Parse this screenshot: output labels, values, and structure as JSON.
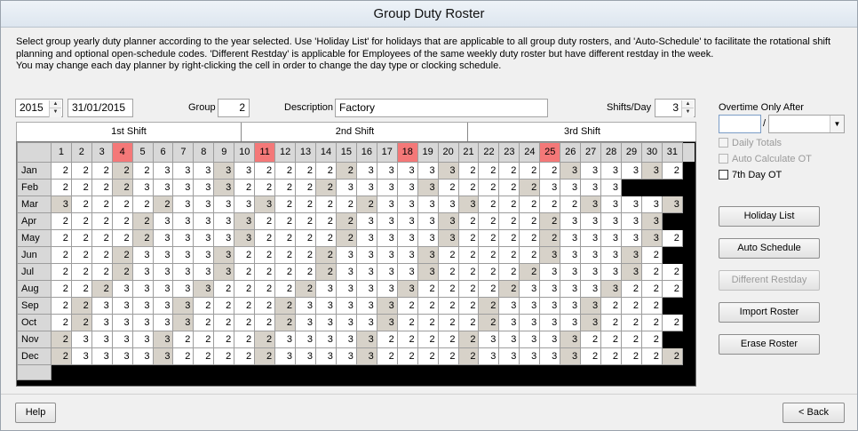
{
  "window": {
    "title": "Group Duty Roster"
  },
  "instructions": [
    "Select group yearly duty planner according to the year selected. Use 'Holiday List' for holidays that are applicable to all group duty rosters, and 'Auto-Schedule' to facilitate the rotational shift",
    "planning and  optional open-schedule codes. 'Different Restday' is applicable for Employees of the same weekly duty roster but have different restday in the week.",
    "You may change each day planner by right-clicking the cell in order to change the day type or clocking schedule."
  ],
  "form": {
    "year": "2015",
    "date": "31/01/2015",
    "group_label": "Group",
    "group_value": "2",
    "description_label": "Description",
    "description_value": "Factory",
    "shifts_label": "Shifts/Day",
    "shifts_value": "3"
  },
  "shifts": [
    "1st Shift",
    "2nd Shift",
    "3rd Shift"
  ],
  "grid": {
    "days": [
      "1",
      "2",
      "3",
      "4",
      "5",
      "6",
      "7",
      "8",
      "9",
      "10",
      "11",
      "12",
      "13",
      "14",
      "15",
      "16",
      "17",
      "18",
      "19",
      "20",
      "21",
      "22",
      "23",
      "24",
      "25",
      "26",
      "27",
      "28",
      "29",
      "30",
      "31"
    ],
    "holiday_days": [
      4,
      11,
      18,
      25
    ],
    "months": [
      "Jan",
      "Feb",
      "Mar",
      "Apr",
      "May",
      "Jun",
      "Jul",
      "Aug",
      "Sep",
      "Oct",
      "Nov",
      "Dec"
    ],
    "month_lengths": [
      31,
      28,
      31,
      30,
      31,
      30,
      31,
      31,
      30,
      31,
      30,
      31
    ],
    "rows": [
      [
        "2",
        "2",
        "2",
        "2",
        "2",
        "3",
        "3",
        "3",
        "3",
        "3",
        "2",
        "2",
        "2",
        "2",
        "2",
        "3",
        "3",
        "3",
        "3",
        "3",
        "2",
        "2",
        "2",
        "2",
        "2",
        "3",
        "3",
        "3",
        "3",
        "3",
        "2"
      ],
      [
        "2",
        "2",
        "2",
        "2",
        "3",
        "3",
        "3",
        "3",
        "3",
        "2",
        "2",
        "2",
        "2",
        "2",
        "3",
        "3",
        "3",
        "3",
        "3",
        "2",
        "2",
        "2",
        "2",
        "2",
        "3",
        "3",
        "3",
        "3"
      ],
      [
        "3",
        "2",
        "2",
        "2",
        "2",
        "2",
        "3",
        "3",
        "3",
        "3",
        "3",
        "2",
        "2",
        "2",
        "2",
        "2",
        "3",
        "3",
        "3",
        "3",
        "3",
        "2",
        "2",
        "2",
        "2",
        "2",
        "3",
        "3",
        "3",
        "3",
        "3"
      ],
      [
        "2",
        "2",
        "2",
        "2",
        "2",
        "3",
        "3",
        "3",
        "3",
        "3",
        "2",
        "2",
        "2",
        "2",
        "2",
        "3",
        "3",
        "3",
        "3",
        "3",
        "2",
        "2",
        "2",
        "2",
        "2",
        "3",
        "3",
        "3",
        "3",
        "3"
      ],
      [
        "2",
        "2",
        "2",
        "2",
        "2",
        "3",
        "3",
        "3",
        "3",
        "3",
        "2",
        "2",
        "2",
        "2",
        "2",
        "3",
        "3",
        "3",
        "3",
        "3",
        "2",
        "2",
        "2",
        "2",
        "2",
        "3",
        "3",
        "3",
        "3",
        "3",
        "2"
      ],
      [
        "2",
        "2",
        "2",
        "2",
        "3",
        "3",
        "3",
        "3",
        "3",
        "2",
        "2",
        "2",
        "2",
        "2",
        "3",
        "3",
        "3",
        "3",
        "3",
        "2",
        "2",
        "2",
        "2",
        "2",
        "3",
        "3",
        "3",
        "3",
        "3",
        "2"
      ],
      [
        "2",
        "2",
        "2",
        "2",
        "3",
        "3",
        "3",
        "3",
        "3",
        "2",
        "2",
        "2",
        "2",
        "2",
        "3",
        "3",
        "3",
        "3",
        "3",
        "2",
        "2",
        "2",
        "2",
        "2",
        "3",
        "3",
        "3",
        "3",
        "3",
        "2",
        "2"
      ],
      [
        "2",
        "2",
        "2",
        "3",
        "3",
        "3",
        "3",
        "3",
        "2",
        "2",
        "2",
        "2",
        "2",
        "3",
        "3",
        "3",
        "3",
        "3",
        "2",
        "2",
        "2",
        "2",
        "2",
        "3",
        "3",
        "3",
        "3",
        "3",
        "2",
        "2",
        "2"
      ],
      [
        "2",
        "2",
        "3",
        "3",
        "3",
        "3",
        "3",
        "2",
        "2",
        "2",
        "2",
        "2",
        "3",
        "3",
        "3",
        "3",
        "3",
        "2",
        "2",
        "2",
        "2",
        "2",
        "3",
        "3",
        "3",
        "3",
        "3",
        "2",
        "2",
        "2"
      ],
      [
        "2",
        "2",
        "3",
        "3",
        "3",
        "3",
        "3",
        "2",
        "2",
        "2",
        "2",
        "2",
        "3",
        "3",
        "3",
        "3",
        "3",
        "2",
        "2",
        "2",
        "2",
        "2",
        "3",
        "3",
        "3",
        "3",
        "3",
        "2",
        "2",
        "2",
        "2"
      ],
      [
        "2",
        "3",
        "3",
        "3",
        "3",
        "3",
        "2",
        "2",
        "2",
        "2",
        "2",
        "3",
        "3",
        "3",
        "3",
        "3",
        "2",
        "2",
        "2",
        "2",
        "2",
        "3",
        "3",
        "3",
        "3",
        "3",
        "2",
        "2",
        "2",
        "2"
      ],
      [
        "2",
        "3",
        "3",
        "3",
        "3",
        "3",
        "2",
        "2",
        "2",
        "2",
        "2",
        "3",
        "3",
        "3",
        "3",
        "3",
        "2",
        "2",
        "2",
        "2",
        "2",
        "3",
        "3",
        "3",
        "3",
        "3",
        "2",
        "2",
        "2",
        "2",
        "2"
      ]
    ],
    "restdays": [
      [
        4,
        9,
        15,
        20,
        26,
        30
      ],
      [
        4,
        9,
        14,
        19,
        24
      ],
      [
        1,
        6,
        11,
        16,
        21,
        27,
        31
      ],
      [
        5,
        10,
        15,
        20,
        25,
        30
      ],
      [
        5,
        10,
        15,
        20,
        25,
        30
      ],
      [
        4,
        9,
        14,
        19,
        25,
        29
      ],
      [
        4,
        9,
        14,
        19,
        24,
        29
      ],
      [
        3,
        8,
        13,
        18,
        23,
        28
      ],
      [
        2,
        7,
        12,
        17,
        22,
        27
      ],
      [
        2,
        7,
        12,
        17,
        22,
        27
      ],
      [
        1,
        6,
        11,
        16,
        21,
        26
      ],
      [
        1,
        6,
        11,
        16,
        21,
        26,
        31
      ]
    ]
  },
  "side": {
    "ot_label": "Overtime Only After",
    "ot_value": "",
    "ot_unit": "",
    "daily_totals": "Daily Totals",
    "auto_calc_ot": "Auto Calculate OT",
    "seventh_day_ot": "7th Day OT"
  },
  "buttons": {
    "holiday_list": "Holiday List",
    "auto_schedule": "Auto Schedule",
    "different_restday": "Different Restday",
    "import_roster": "Import Roster",
    "erase_roster": "Erase Roster",
    "help": "Help",
    "back": "< Back"
  }
}
